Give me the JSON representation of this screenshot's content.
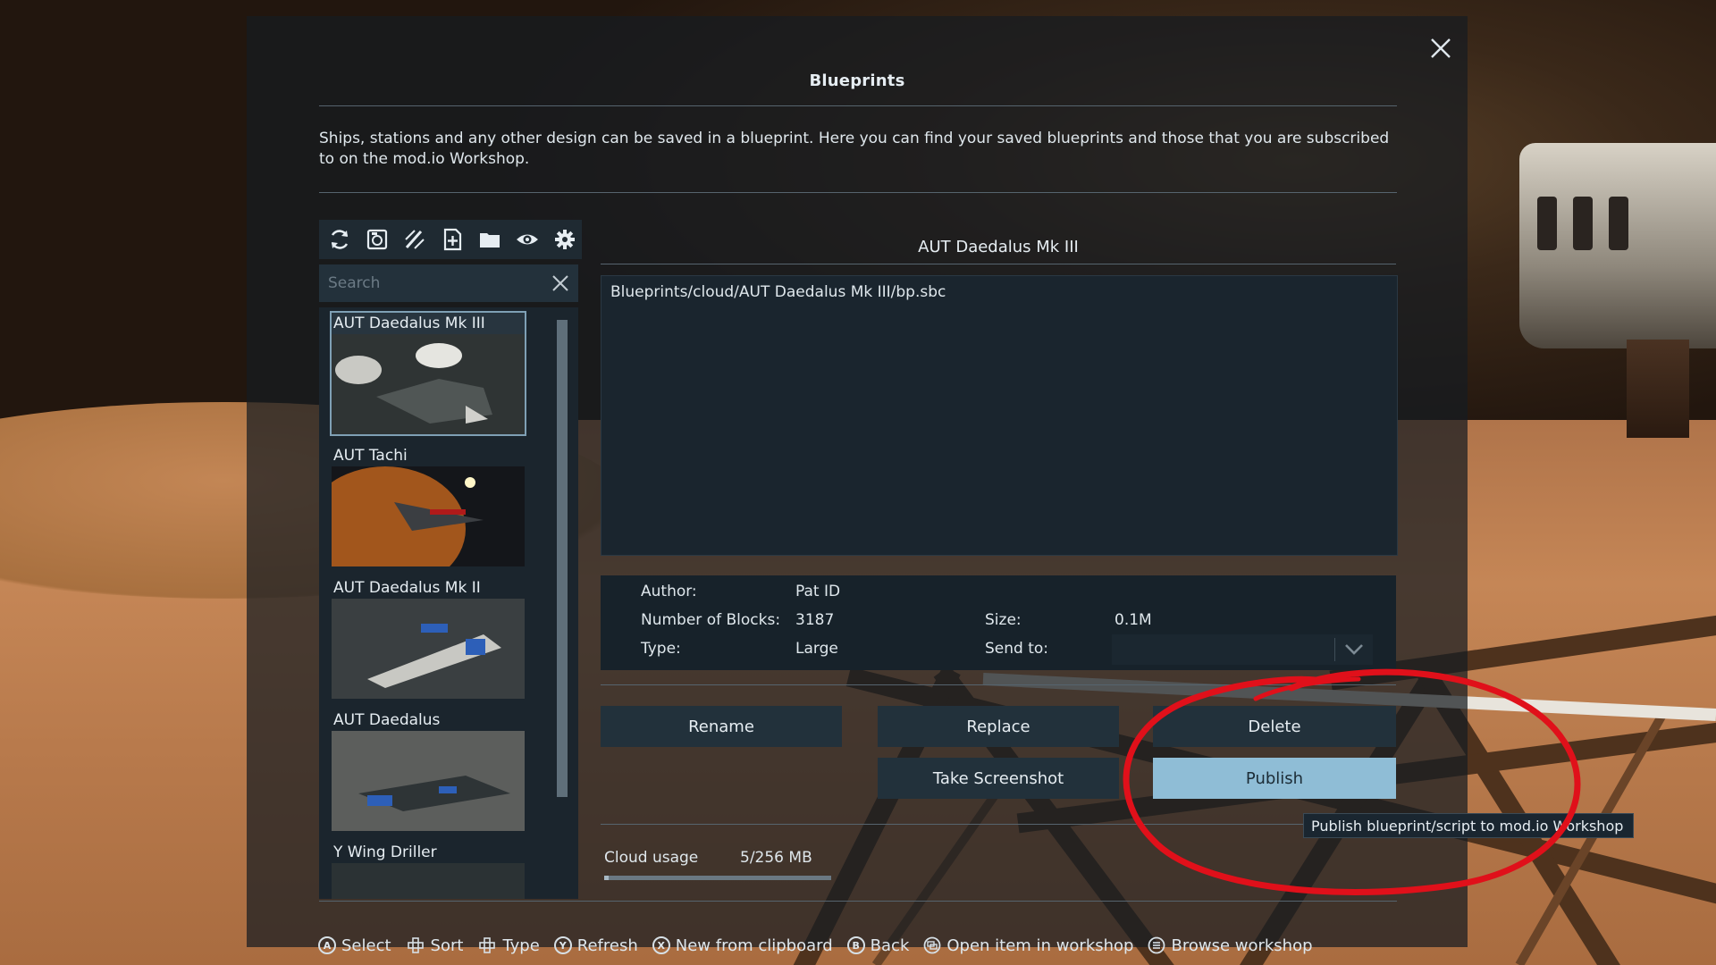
{
  "window": {
    "title": "Blueprints",
    "close_icon": "close-icon",
    "description": "Ships, stations and any other design can be saved in a blueprint. Here you can find your saved blueprints and those that you are subscribed to on the mod.io Workshop."
  },
  "toolbar": {
    "icons": [
      "refresh-icon",
      "new-blueprint-icon",
      "edit-blueprint-icon",
      "add-blueprint-icon",
      "folder-icon",
      "eye-icon",
      "gear-icon"
    ]
  },
  "search": {
    "placeholder": "Search",
    "value": ""
  },
  "blueprints": [
    {
      "name": "AUT Daedalus Mk III",
      "selected": true
    },
    {
      "name": "AUT Tachi",
      "selected": false
    },
    {
      "name": "AUT Daedalus Mk II",
      "selected": false
    },
    {
      "name": "AUT Daedalus",
      "selected": false
    },
    {
      "name": "Y Wing Driller",
      "selected": false
    }
  ],
  "details": {
    "title": "AUT Daedalus Mk III",
    "description": "Blueprints/cloud/AUT Daedalus Mk III/bp.sbc",
    "author_label": "Author:",
    "author_value": "Pat ID",
    "blocks_label": "Number of Blocks:",
    "blocks_value": "3187",
    "type_label": "Type:",
    "type_value": "Large",
    "size_label": "Size:",
    "size_value": "0.1M",
    "send_label": "Send to:",
    "send_value": ""
  },
  "buttons": {
    "rename": "Rename",
    "replace": "Replace",
    "delete": "Delete",
    "screenshot": "Take Screenshot",
    "publish": "Publish"
  },
  "tooltip": "Publish blueprint/script to mod.io Workshop",
  "cloud": {
    "label": "Cloud usage",
    "value": "5/256 MB",
    "fraction": 0.02
  },
  "hints": [
    {
      "icon": "a-button-icon",
      "glyph": "A",
      "label": "Select"
    },
    {
      "icon": "dpad-icon",
      "glyph": "",
      "label": "Sort"
    },
    {
      "icon": "dpad-icon",
      "glyph": "",
      "label": "Type"
    },
    {
      "icon": "y-button-icon",
      "glyph": "Y",
      "label": "Refresh"
    },
    {
      "icon": "x-button-icon",
      "glyph": "X",
      "label": "New from clipboard"
    },
    {
      "icon": "b-button-icon",
      "glyph": "B",
      "label": "Back"
    },
    {
      "icon": "view-button-icon",
      "glyph": "",
      "label": "Open item in workshop"
    },
    {
      "icon": "menu-button-icon",
      "glyph": "",
      "label": "Browse workshop"
    }
  ],
  "colors": {
    "accent": "#8fbdd6",
    "panel": "#1b252d",
    "annotation": "#e0101a"
  }
}
